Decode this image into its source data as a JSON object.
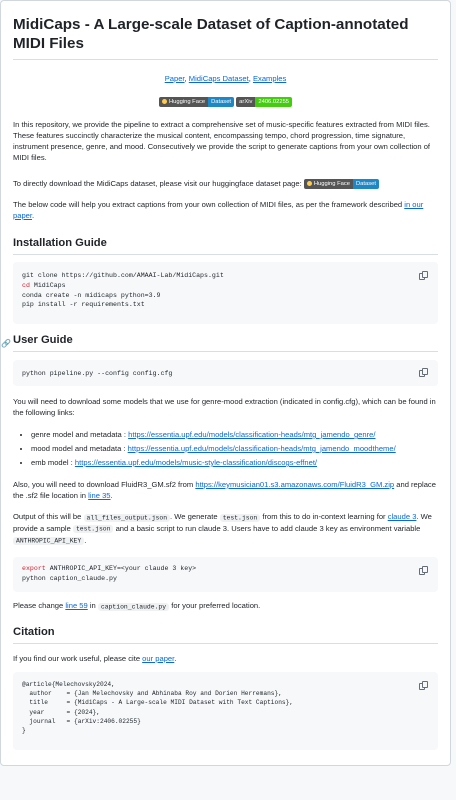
{
  "title": "MidiCaps - A Large-scale Dataset of Caption-annotated MIDI Files",
  "links": {
    "paper": "Paper",
    "dataset": "MidiCaps Dataset",
    "examples": "Examples",
    "sep": ", "
  },
  "badges": {
    "hf_label": "Hugging Face",
    "hf_value": "Dataset",
    "arxiv_label": "arXiv",
    "arxiv_value": "2406.02255"
  },
  "intro": {
    "p1": "In this repository, we provide the pipeline to extract a comprehensive set of music-specific features extracted from MIDI files. These features succinctly characterize the musical content, encompassing tempo, chord progression, time signature, instrument presence, genre, and mood. Consecutively we provide the script to generate captions from your own collection of MIDI files.",
    "p2": "To directly download the MidiCaps dataset, please visit our huggingface dataset page:",
    "p3_pre": "The below code will help you extract captions from your own collection of MIDI files, as per the framework described ",
    "p3_link": "in our paper",
    "p3_post": "."
  },
  "install": {
    "heading": "Installation Guide",
    "code": [
      "git clone https://github.com/AMAAI-Lab/MidiCaps.git",
      "cd MidiCaps",
      "conda create -n midicaps python=3.9",
      "pip install -r requirements.txt"
    ],
    "cd_kw": "cd",
    "cd_rest": " MidiCaps"
  },
  "user": {
    "heading": "User Guide",
    "code": "python pipeline.py --config config.cfg",
    "p1": "You will need to download some models that we use for genre-mood extraction (indicated in config.cfg), which can be found in the following links:",
    "items": [
      {
        "label": "genre model and metadata : ",
        "link": "https://essentia.upf.edu/models/classification-heads/mtg_jamendo_genre/"
      },
      {
        "label": "mood model and metadata : ",
        "link": "https://essentia.upf.edu/models/classification-heads/mtg_jamendo_moodtheme/"
      },
      {
        "label": "emb model : ",
        "link": "https://essentia.upf.edu/models/music-style-classification/discogs-effnet/"
      }
    ],
    "p2_pre": "Also, you will need to download FluidR3_GM.sf2 from ",
    "p2_link": "https://keymusician01.s3.amazonaws.com/FluidR3_GM.zip",
    "p2_mid": " and replace the .sf2 file location in ",
    "p2_link2": "line 35",
    "p2_post": ".",
    "p3_a": "Output of this will be ",
    "p3_code1": "all_files_output.json",
    "p3_b": ". We generate ",
    "p3_code2": "test.json",
    "p3_c": " from this to do in-context learning for ",
    "p3_link": "claude 3",
    "p3_d": ". We provide a sample ",
    "p3_code3": "test.json",
    "p3_e": " and a basic script to run claude 3. Users have to add claude 3 key as environment variable ",
    "p3_code4": "ANTHROPIC_API_KEY",
    "p3_f": ".",
    "code2_kw": "export",
    "code2_rest": " ANTHROPIC_API_KEY=<your claude 3 key>",
    "code2_line2": "python caption_claude.py",
    "p4_a": "Please change ",
    "p4_link": "line 59",
    "p4_b": " in ",
    "p4_code": "caption_claude.py",
    "p4_c": " for your preferred location."
  },
  "citation": {
    "heading": "Citation",
    "p_pre": "If you find our work useful, please cite ",
    "p_link": "our paper",
    "p_post": ".",
    "code": [
      "@article{Melechovsky2024,",
      "  author    = {Jan Melechovsky and Abhinaba Roy and Dorien Herremans},",
      "  title     = {MidiCaps - A Large-scale MIDI Dataset with Text Captions},",
      "  year      = {2024},",
      "  journal   = {arXiv:2406.02255}",
      "}"
    ]
  }
}
